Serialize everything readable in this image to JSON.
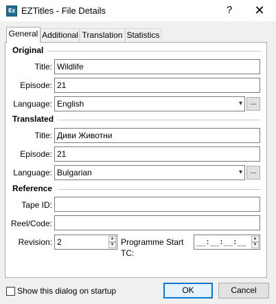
{
  "window": {
    "app_icon_text": "Ez",
    "title": "EZTitles - File Details",
    "help_glyph": "?",
    "close_glyph": "✕"
  },
  "tabs": [
    {
      "label": "General",
      "active": true
    },
    {
      "label": "Additional",
      "active": false
    },
    {
      "label": "Translation",
      "active": false
    },
    {
      "label": "Statistics",
      "active": false
    }
  ],
  "original": {
    "heading": "Original",
    "title_label": "Title:",
    "title_value": "Wildlife",
    "episode_label": "Episode:",
    "episode_value": "21",
    "language_label": "Language:",
    "language_value": "English",
    "more_button": "..."
  },
  "translated": {
    "heading": "Translated",
    "title_label": "Title:",
    "title_value": "Диви Животни",
    "episode_label": "Episode:",
    "episode_value": "21",
    "language_label": "Language:",
    "language_value": "Bulgarian",
    "more_button": "..."
  },
  "reference": {
    "heading": "Reference",
    "tape_id_label": "Tape ID:",
    "tape_id_value": "",
    "reel_code_label": "Reel/Code:",
    "reel_code_value": "",
    "revision_label": "Revision:",
    "revision_value": "2",
    "start_tc_label": "Programme Start TC:",
    "start_tc_value": "__:__:__:__"
  },
  "footer": {
    "show_on_startup_label": "Show this dialog on startup",
    "show_on_startup_checked": false,
    "ok_label": "OK",
    "cancel_label": "Cancel"
  },
  "icons": {
    "dropdown": "▾",
    "spin_up": "▲",
    "spin_down": "▼"
  }
}
